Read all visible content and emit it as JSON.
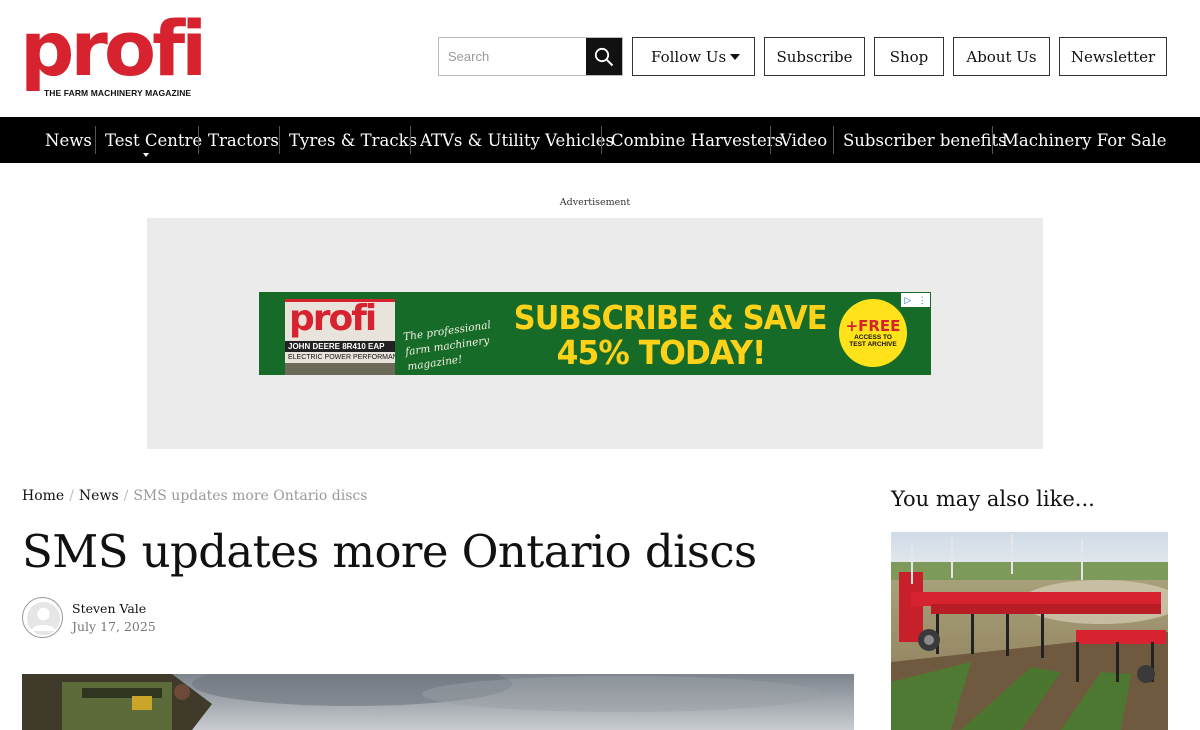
{
  "header": {
    "logo_word": "profi",
    "logo_tagline": "THE FARM MACHINERY MAGAZINE",
    "search_placeholder": "Search",
    "buttons": {
      "follow": "Follow Us",
      "subscribe": "Subscribe",
      "shop": "Shop",
      "about": "About Us",
      "newsletter": "Newsletter"
    }
  },
  "nav": {
    "items": [
      "News",
      "Test Centre",
      "Tractors",
      "Tyres & Tracks",
      "ATVs & Utility Vehicles",
      "Combine Harvesters",
      "Video",
      "Subscriber benefits",
      "Machinery For Sale"
    ]
  },
  "ad": {
    "label": "Advertisement",
    "banner": {
      "magazine_word": "profi",
      "magazine_cover_line": "JOHN DEERE 8R410 EAP",
      "magazine_sub_line": "ELECTRIC POWER PERFORMANCE",
      "script_text": "The professional farm machinery magazine!",
      "headline_1": "SUBSCRIBE & SAVE",
      "headline_2": "45% TODAY!",
      "badge_big": "+FREE",
      "badge_small": "ACCESS TO TEST ARCHIVE"
    }
  },
  "article": {
    "breadcrumb": {
      "home": "Home",
      "section": "News",
      "current": "SMS updates more Ontario discs"
    },
    "title": "SMS updates more Ontario discs",
    "author": "Steven Vale",
    "date": "July 17, 2025"
  },
  "sidebar": {
    "heading": "You may also like..."
  },
  "colors": {
    "brand_red": "#d6232f",
    "nav_bg": "#000000",
    "ad_green": "#176b28",
    "ad_yellow": "#ffd21a"
  },
  "icons": {
    "search": "search-icon",
    "follow_caret": "caret-down-icon",
    "avatar": "user-avatar-icon"
  }
}
